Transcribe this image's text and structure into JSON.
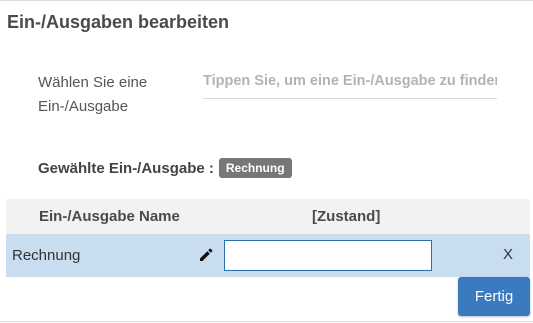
{
  "dialog": {
    "title": "Ein-/Ausgaben bearbeiten"
  },
  "chooser": {
    "label": "Wählen Sie eine Ein-/Ausgabe",
    "search_placeholder": "Tippen Sie, um eine Ein-/Ausgabe zu finden",
    "search_value": ""
  },
  "selected": {
    "label": "Gewählte Ein-/Ausgabe :",
    "badge": "Rechnung"
  },
  "table": {
    "headers": {
      "name": "Ein-/Ausgabe Name",
      "state": "[Zustand]"
    },
    "rows": [
      {
        "name": "Rechnung",
        "state_value": "",
        "remove_label": "X"
      }
    ]
  },
  "footer": {
    "done_label": "Fertig"
  },
  "colors": {
    "accent": "#3a7bbf",
    "row_selected": "#c8ddf0",
    "badge": "#777777"
  },
  "icons": {
    "edit": "pencil-icon"
  }
}
